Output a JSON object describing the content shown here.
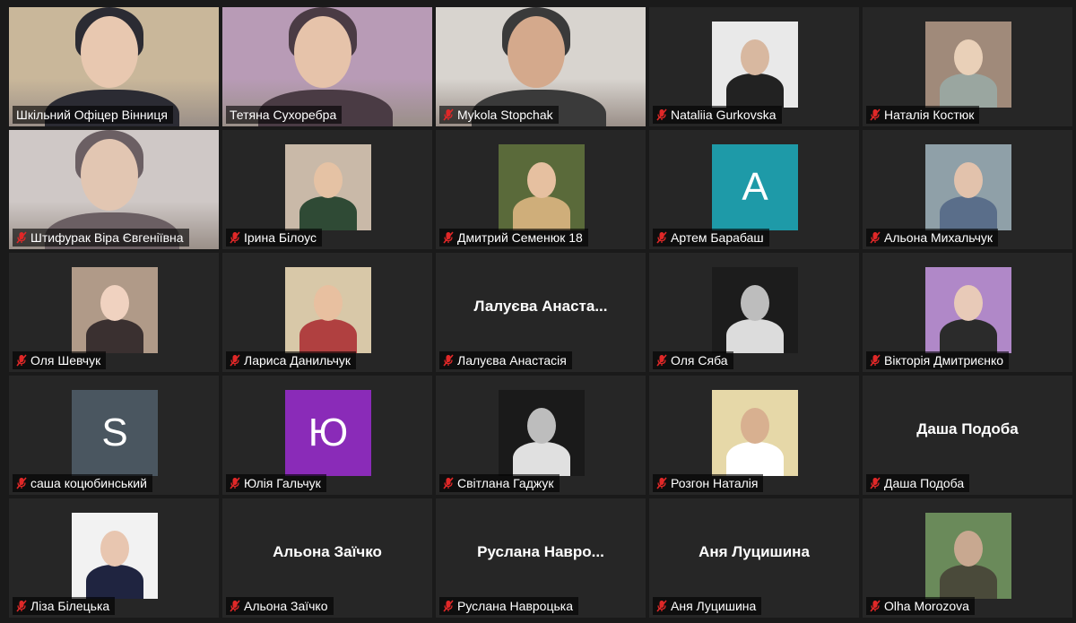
{
  "participants": [
    {
      "name": "Шкільний Офіцер Вінниця",
      "muted": false,
      "type": "video",
      "active": true
    },
    {
      "name": "Тетяна Сухоребра",
      "muted": false,
      "type": "video"
    },
    {
      "name": "Mykola Stopchak",
      "muted": true,
      "type": "video"
    },
    {
      "name": "Nataliia Gurkovska",
      "muted": true,
      "type": "photo"
    },
    {
      "name": "Наталія Костюк",
      "muted": true,
      "type": "photo"
    },
    {
      "name": "Штифурак Віра Євгеніївна",
      "muted": true,
      "type": "video"
    },
    {
      "name": "Ірина Білоус",
      "muted": true,
      "type": "photo"
    },
    {
      "name": "Дмитрий Семенюк 18",
      "muted": true,
      "type": "photo"
    },
    {
      "name": "Артем Барабаш",
      "muted": true,
      "type": "initial",
      "initial": "A",
      "color": "#1e9aa8"
    },
    {
      "name": "Альона Михальчук",
      "muted": true,
      "type": "photo"
    },
    {
      "name": "Оля Шевчук",
      "muted": true,
      "type": "photo"
    },
    {
      "name": "Лариса Данильчук",
      "muted": true,
      "type": "photo"
    },
    {
      "name": "Лалуєва Анастасія",
      "muted": true,
      "type": "name",
      "display": "Лалуєва Анаста..."
    },
    {
      "name": "Оля Сяба",
      "muted": true,
      "type": "photo"
    },
    {
      "name": "Вікторія Дмитриєнко",
      "muted": true,
      "type": "photo"
    },
    {
      "name": "саша коцюбинський",
      "muted": true,
      "type": "initial",
      "initial": "S",
      "color": "#4a5660"
    },
    {
      "name": "Юлія Гальчук",
      "muted": true,
      "type": "initial",
      "initial": "Ю",
      "color": "#8a2bb8"
    },
    {
      "name": "Світлана Гаджук",
      "muted": true,
      "type": "photo"
    },
    {
      "name": "Розгон Наталія",
      "muted": true,
      "type": "photo"
    },
    {
      "name": "Даша Подоба",
      "muted": true,
      "type": "name",
      "display": "Даша Подоба"
    },
    {
      "name": "Ліза Білецька",
      "muted": true,
      "type": "photo"
    },
    {
      "name": "Альона Заїчко",
      "muted": true,
      "type": "name",
      "display": "Альона Заїчко"
    },
    {
      "name": "Руслана Навроцька",
      "muted": true,
      "type": "name",
      "display": "Руслана  Навро..."
    },
    {
      "name": "Аня Луцишина",
      "muted": true,
      "type": "name",
      "display": "Аня Луцишина"
    },
    {
      "name": "Olha Morozova",
      "muted": true,
      "type": "photo"
    }
  ],
  "colors": {
    "active_border": "#c9e04a",
    "muted_icon": "#e02828",
    "tile_bg": "#262626"
  }
}
